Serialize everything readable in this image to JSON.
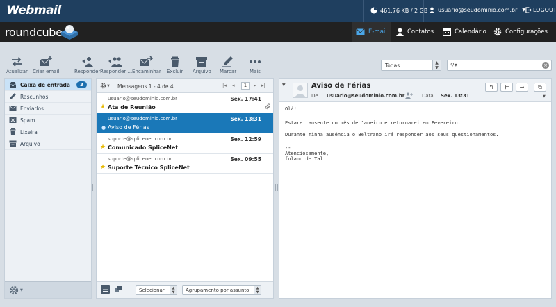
{
  "topbar": {
    "logo": "Webmail",
    "quota": "461,76 KB / 2 GB",
    "user": "usuario@seudominio.com.br",
    "logout": "LOGOUT"
  },
  "navbar": {
    "logo": "roundcube",
    "tabs": [
      {
        "label": "E-mail",
        "icon": "envelope-icon",
        "active": true
      },
      {
        "label": "Contatos",
        "icon": "person-icon",
        "active": false
      },
      {
        "label": "Calendário",
        "icon": "calendar-icon",
        "active": false
      },
      {
        "label": "Configurações",
        "icon": "gear-icon",
        "active": false
      }
    ]
  },
  "toolbar": {
    "buttons": [
      {
        "label": "Atualizar",
        "icon": "refresh-icon"
      },
      {
        "label": "Criar email",
        "icon": "compose-icon"
      },
      {
        "label": "Responder",
        "icon": "reply-icon"
      },
      {
        "label": "Responder ...",
        "icon": "reply-all-icon"
      },
      {
        "label": "Encaminhar",
        "icon": "forward-icon"
      },
      {
        "label": "Excluir",
        "icon": "trash-icon"
      },
      {
        "label": "Arquivo",
        "icon": "archive-icon"
      },
      {
        "label": "Marcar",
        "icon": "pencil-icon"
      },
      {
        "label": "Mais",
        "icon": "more-icon"
      }
    ],
    "filter_value": "Todas",
    "search_value": ""
  },
  "folders": {
    "items": [
      {
        "label": "Caixa de entrada",
        "icon": "inbox-icon",
        "count": "3",
        "selected": true
      },
      {
        "label": "Rascunhos",
        "icon": "drafts-icon",
        "count": "",
        "selected": false
      },
      {
        "label": "Enviados",
        "icon": "sent-icon",
        "count": "",
        "selected": false
      },
      {
        "label": "Spam",
        "icon": "spam-icon",
        "count": "",
        "selected": false
      },
      {
        "label": "Lixeira",
        "icon": "trash-icon",
        "count": "",
        "selected": false
      },
      {
        "label": "Arquivo",
        "icon": "archive-icon",
        "count": "",
        "selected": false
      }
    ]
  },
  "messagelist": {
    "header": "Mensagens 1 - 4 de 4",
    "page": "1",
    "messages": [
      {
        "from": "usuario@seudominio.com.br",
        "date": "Sex. 17:41",
        "subject": "Ata de Reunião",
        "flagged": true,
        "attachment": true,
        "selected": false
      },
      {
        "from": "usuario@seudominio.com.br",
        "date": "Sex. 13:31",
        "subject": "Aviso de Férias",
        "flagged": false,
        "attachment": false,
        "selected": true
      },
      {
        "from": "suporte@splicenet.com.br",
        "date": "Sex. 12:59",
        "subject": "Comunicado SpliceNet",
        "flagged": true,
        "attachment": false,
        "selected": false
      },
      {
        "from": "suporte@splicenet.com.br",
        "date": "Sex. 09:55",
        "subject": "Suporte Técnico SpliceNet",
        "flagged": true,
        "attachment": false,
        "selected": false
      }
    ],
    "footer_select": "Selecionar",
    "footer_group": "Agrupamento por assunto"
  },
  "preview": {
    "subject": "Aviso de Férias",
    "from_label": "De",
    "from": "usuario@seudominio.com.br",
    "date_label": "Data",
    "date": "Sex. 13:31",
    "body": [
      "Olá!",
      "Estarei ausente no mês de Janeiro e retornarei em Fevereiro.",
      "Durante minha ausência o Beltrano irá responder aos seus questionamentos.",
      "--",
      "Atenciosamente,",
      "fulano de Tal"
    ]
  },
  "colors": {
    "topbar": "#1f3f5f",
    "navbar": "#212121",
    "accent": "#1a78b8",
    "flag": "#e6b800"
  }
}
